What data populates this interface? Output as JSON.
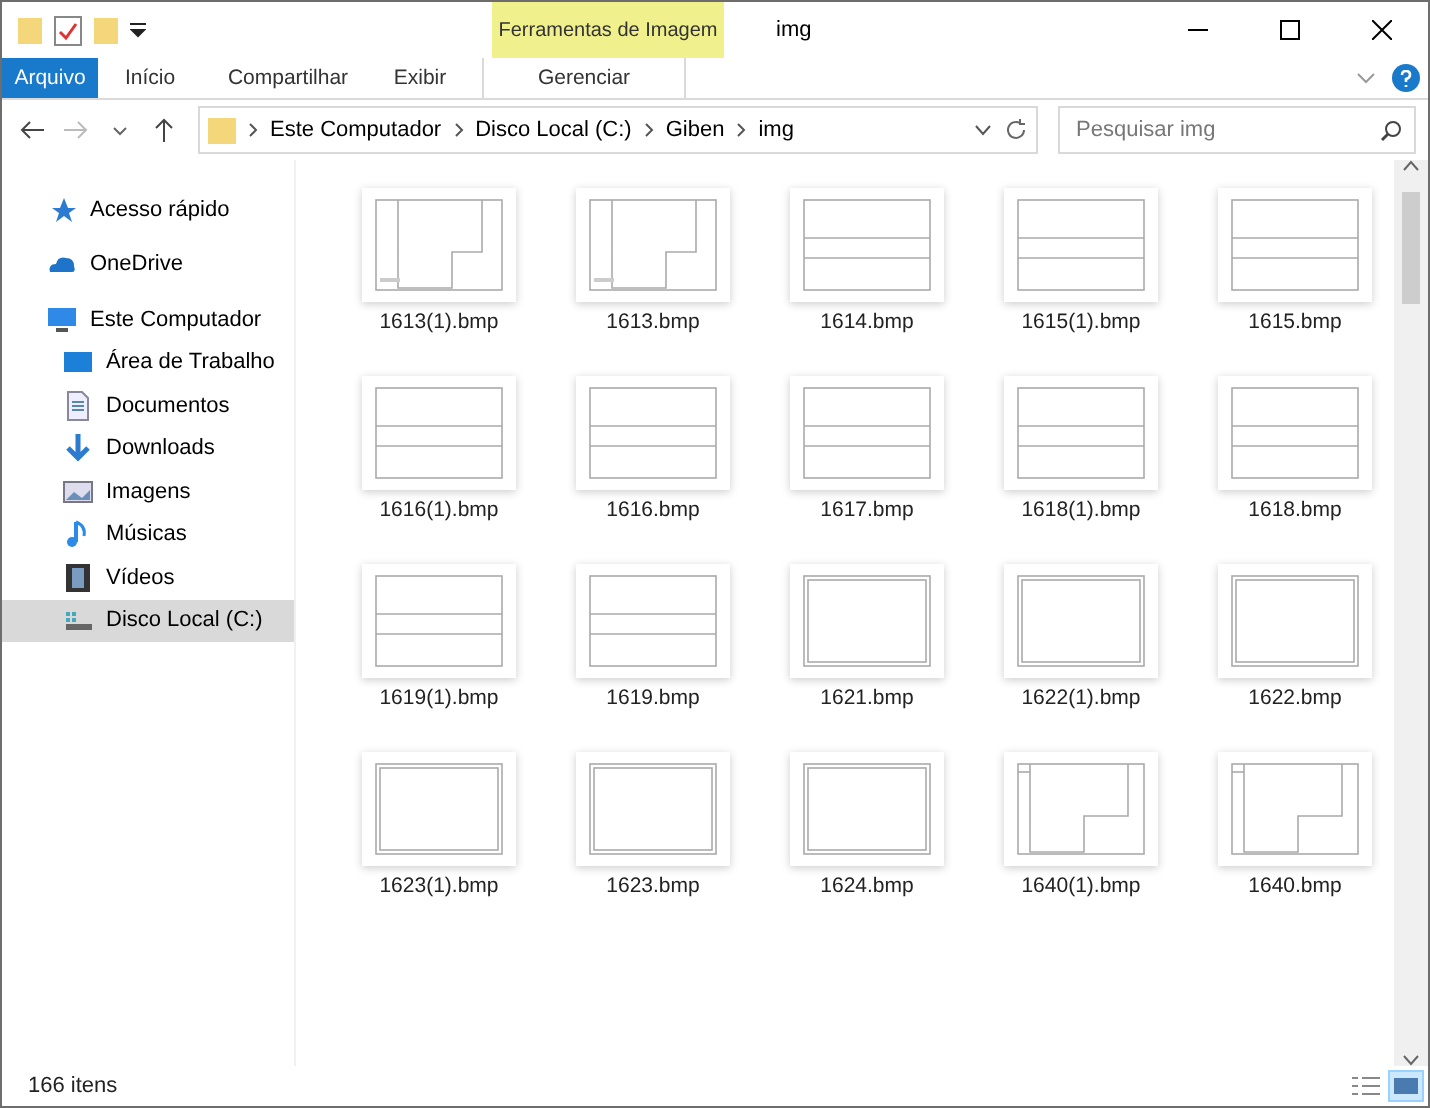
{
  "title_bar": {
    "context_tab": "Ferramentas de Imagem",
    "title": "img"
  },
  "ribbon": {
    "tabs": [
      {
        "label": "Arquivo",
        "selected": true
      },
      {
        "label": "Início",
        "selected": false
      },
      {
        "label": "Compartilhar",
        "selected": false
      },
      {
        "label": "Exibir",
        "selected": false
      },
      {
        "label": "Gerenciar",
        "selected": false
      }
    ]
  },
  "address": {
    "crumbs": [
      "Este Computador",
      "Disco Local (C:)",
      "Giben",
      "img"
    ],
    "search_placeholder": "Pesquisar img"
  },
  "sidebar": {
    "items": [
      {
        "label": "Acesso rápido",
        "selected": false
      },
      {
        "label": "OneDrive",
        "selected": false
      },
      {
        "label": "Este Computador",
        "selected": false,
        "children": [
          {
            "label": "Área de Trabalho",
            "selected": false
          },
          {
            "label": "Documentos",
            "selected": false
          },
          {
            "label": "Downloads",
            "selected": false
          },
          {
            "label": "Imagens",
            "selected": false
          },
          {
            "label": "Músicas",
            "selected": false
          },
          {
            "label": "Vídeos",
            "selected": false
          },
          {
            "label": "Disco Local (C:)",
            "selected": true
          }
        ]
      }
    ]
  },
  "files": [
    {
      "name": "1613(1).bmp",
      "kind": "lshape"
    },
    {
      "name": "1613.bmp",
      "kind": "lshape"
    },
    {
      "name": "1614.bmp",
      "kind": "band"
    },
    {
      "name": "1615(1).bmp",
      "kind": "band"
    },
    {
      "name": "1615.bmp",
      "kind": "band"
    },
    {
      "name": "1616(1).bmp",
      "kind": "band"
    },
    {
      "name": "1616.bmp",
      "kind": "band"
    },
    {
      "name": "1617.bmp",
      "kind": "band"
    },
    {
      "name": "1618(1).bmp",
      "kind": "band"
    },
    {
      "name": "1618.bmp",
      "kind": "band"
    },
    {
      "name": "1619(1).bmp",
      "kind": "band"
    },
    {
      "name": "1619.bmp",
      "kind": "band"
    },
    {
      "name": "1621.bmp",
      "kind": "frame"
    },
    {
      "name": "1622(1).bmp",
      "kind": "frame"
    },
    {
      "name": "1622.bmp",
      "kind": "frame"
    },
    {
      "name": "1623(1).bmp",
      "kind": "frame"
    },
    {
      "name": "1623.bmp",
      "kind": "frame"
    },
    {
      "name": "1624.bmp",
      "kind": "frame"
    },
    {
      "name": "1640(1).bmp",
      "kind": "step"
    },
    {
      "name": "1640.bmp",
      "kind": "step"
    }
  ],
  "status_bar": {
    "count": "166 itens"
  }
}
